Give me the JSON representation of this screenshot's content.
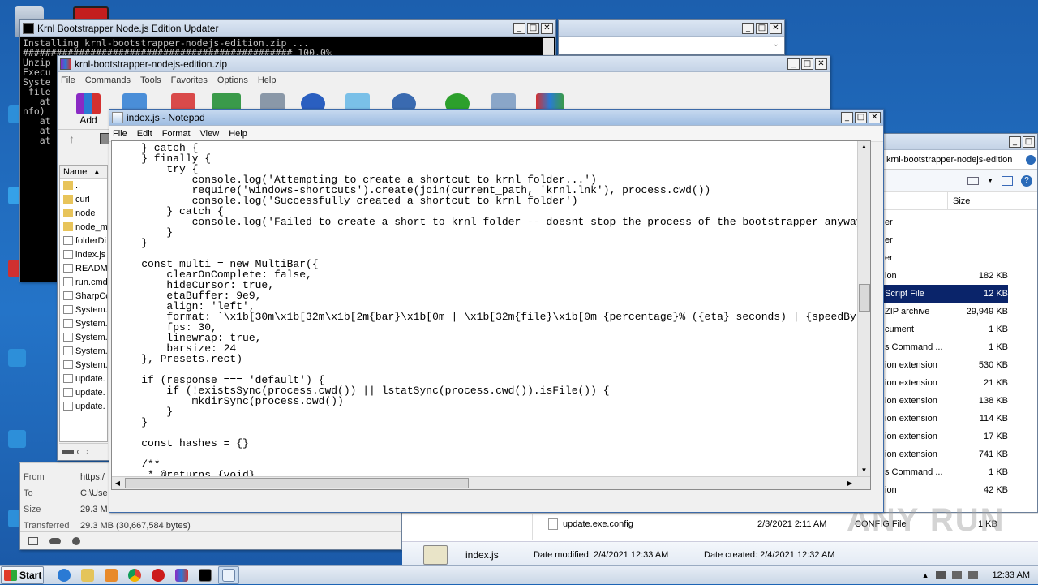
{
  "console": {
    "title": "Krnl Bootstrapper Node.js Edition Updater",
    "lines": [
      "Installing krnl-bootstrapper-nodejs-edition.zip ...",
      "################################################ 100.0%",
      "Unzip",
      "Execu",
      "Syste",
      " file",
      "   at",
      "nfo)",
      "   at",
      "   at",
      "   at"
    ]
  },
  "winrar": {
    "title": "krnl-bootstrapper-nodejs-edition.zip",
    "menu": [
      "File",
      "Commands",
      "Tools",
      "Favorites",
      "Options",
      "Help"
    ],
    "add_label": "Add",
    "column_name": "Name",
    "files": [
      "..",
      "curl",
      "node",
      "node_m",
      "folderDi",
      "index.js",
      "READMI",
      "run.cmd",
      "SharpCo",
      "System.",
      "System.",
      "System.",
      "System.",
      "System.",
      "update.",
      "update.",
      "update."
    ]
  },
  "download": {
    "labels": [
      "From",
      "To",
      "Size",
      "Transferred"
    ],
    "values": [
      "https:/",
      "C:\\Use",
      "29.3 M",
      "29.3 MB (30,667,584 bytes)"
    ]
  },
  "explorer": {
    "address": "krnl-bootstrapper-nodejs-edition",
    "col_size": "Size",
    "rows": [
      {
        "type": "er",
        "size": ""
      },
      {
        "type": "er",
        "size": ""
      },
      {
        "type": "er",
        "size": ""
      },
      {
        "type": "ion",
        "size": "182 KB"
      },
      {
        "type": "Script File",
        "size": "12 KB"
      },
      {
        "type": "ZIP archive",
        "size": "29,949 KB"
      },
      {
        "type": "cument",
        "size": "1 KB"
      },
      {
        "type": "s Command ...",
        "size": "1 KB"
      },
      {
        "type": "ion extension",
        "size": "530 KB"
      },
      {
        "type": "ion extension",
        "size": "21 KB"
      },
      {
        "type": "ion extension",
        "size": "138 KB"
      },
      {
        "type": "ion extension",
        "size": "114 KB"
      },
      {
        "type": "ion extension",
        "size": "17 KB"
      },
      {
        "type": "ion extension",
        "size": "741 KB"
      },
      {
        "type": "s Command ...",
        "size": "1 KB"
      },
      {
        "type": "ion",
        "size": "42 KB"
      }
    ],
    "last_row": {
      "name": "update.exe.config",
      "date": "2/3/2021 2:11 AM",
      "type": "CONFIG File",
      "size": "1 KB"
    },
    "details": {
      "name": "index.js",
      "modified": "Date modified: 2/4/2021 12:33 AM",
      "created": "Date created: 2/4/2021 12:32 AM"
    }
  },
  "notepad": {
    "title": "index.js - Notepad",
    "menu": [
      "File",
      "Edit",
      "Format",
      "View",
      "Help"
    ],
    "text": "    } catch {\n    } finally {\n        try {\n            console.log('Attempting to create a shortcut to krnl folder...')\n            require('windows-shortcuts').create(join(current_path, 'krnl.lnk'), process.cwd())\n            console.log('Successfully created a shortcut to krnl folder')\n        } catch {\n            console.log('Failed to create a short to krnl folder -- doesnt stop the process of the bootstrapper anyway')\n        }\n    }\n\n    const multi = new MultiBar({\n        clearOnComplete: false,\n        hideCursor: true,\n        etaBuffer: 9e9,\n        align: 'left',\n        format: `\\x1b[30m\\x1b[32m\\x1b[2m{bar}\\x1b[0m | \\x1b[32m{file}\\x1b[0m {percentage}% ({eta} seconds) | {speedBy\n        fps: 30,\n        linewrap: true,\n        barsize: 24\n    }, Presets.rect)\n\n    if (response === 'default') {\n        if (!existsSync(process.cwd()) || lstatSync(process.cwd()).isFile()) {\n            mkdirSync(process.cwd())\n        }\n    }\n\n    const hashes = {}\n\n    /**\n     * @returns {void}\n     */"
  },
  "taskbar": {
    "start_label": "Start",
    "clock": "12:33 AM"
  },
  "watermark": "ANY RUN",
  "colors": {
    "selection": "#0a246a",
    "desktop": "#1d64b5"
  }
}
